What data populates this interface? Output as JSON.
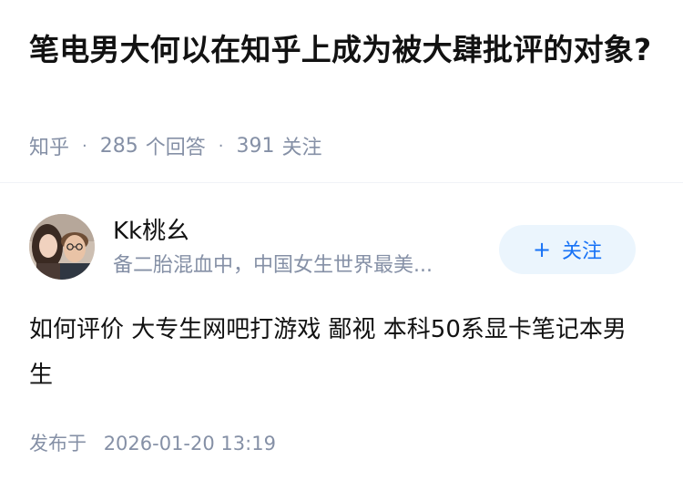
{
  "question": {
    "title": "笔电男大何以在知乎上成为被大肆批评的对象?",
    "source": "知乎",
    "answer_count": "285",
    "answer_label": "个回答",
    "follower_count": "391",
    "follower_label": "关注"
  },
  "answer": {
    "author_name": "Kk桃幺",
    "author_bio": "备二胎混血中，中国女生世界最美...",
    "follow_label": "关注",
    "follow_icon": "plus-icon",
    "content": "如何评价 大专生网吧打游戏 鄙视 本科50系显卡笔记本男生",
    "published_label": "发布于",
    "published_time": "2026-01-20 13:19"
  },
  "colors": {
    "accent": "#1772f6",
    "follow_bg": "#ebf5fd",
    "meta_text": "#8590a6",
    "primary_text": "#121212"
  }
}
